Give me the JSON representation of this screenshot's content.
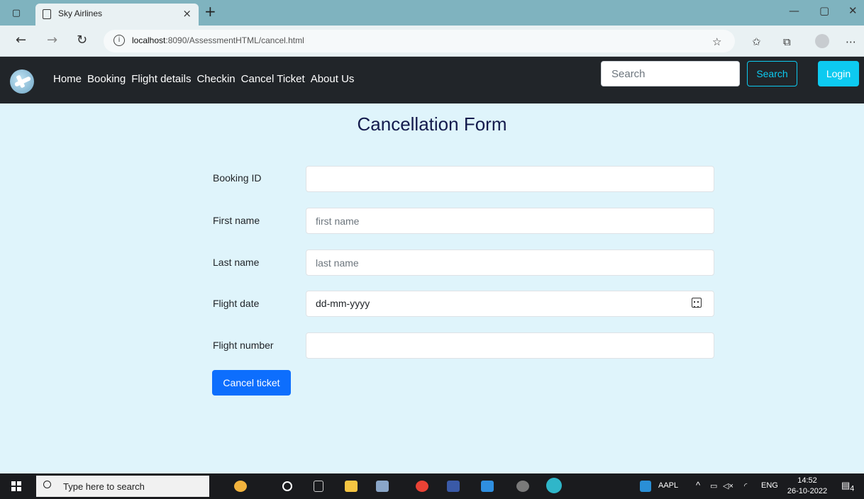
{
  "browser": {
    "tab_title": "Sky Airlines",
    "tab_close": "×",
    "new_tab": "+",
    "url_host": "localhost",
    "url_path": ":8090/AssessmentHTML/cancel.html",
    "window_controls": {
      "minimize": "—",
      "maximize": "▢",
      "close": "✕"
    }
  },
  "navbar": {
    "links": [
      "Home",
      "Booking",
      "Flight details",
      "Checkin",
      "Cancel Ticket",
      "About Us"
    ],
    "search_placeholder": "Search",
    "search_button": "Search",
    "login_button": "Login",
    "colors": {
      "bar": "#212529",
      "search_accent": "#0dcaf0",
      "login": "#0dcaf0"
    }
  },
  "form": {
    "title": "Cancellation Form",
    "fields": [
      {
        "label": "Booking ID",
        "placeholder": "",
        "value": ""
      },
      {
        "label": "First name",
        "placeholder": "first name",
        "value": ""
      },
      {
        "label": "Last name",
        "placeholder": "last name",
        "value": ""
      },
      {
        "label": "Flight date",
        "placeholder": "",
        "value": "dd-mm-yyyy"
      },
      {
        "label": "Flight number",
        "placeholder": "",
        "value": ""
      }
    ],
    "submit_label": "Cancel ticket",
    "colors": {
      "background": "#dff4fb",
      "title": "#141b4d",
      "submit": "#0d6efd"
    }
  },
  "taskbar": {
    "search_placeholder": "Type here to search",
    "stock": "AAPL",
    "language": "ENG",
    "time": "14:52",
    "date": "26-10-2022",
    "notifications": "4"
  }
}
